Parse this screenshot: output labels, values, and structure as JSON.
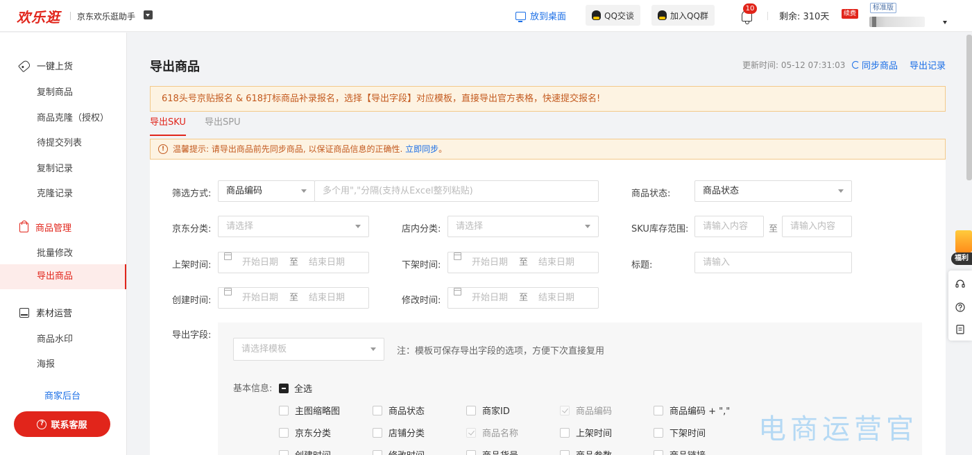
{
  "header": {
    "logo": "欢乐逛",
    "app_name": "京东欢乐逛助手",
    "desktop_link": "放到桌面",
    "qq_chat": "QQ交谈",
    "qq_group": "加入QQ群",
    "notif_count": "10",
    "remaining": "剩余: 310天",
    "renew": "续费",
    "plan": "标准版"
  },
  "sidebar": {
    "group1": "一键上货",
    "group1_items": [
      "复制商品",
      "商品克隆（授权）",
      "待提交列表",
      "复制记录",
      "克隆记录"
    ],
    "group2": "商品管理",
    "group2_items": [
      "批量修改",
      "导出商品"
    ],
    "group3": "素材运营",
    "group3_items": [
      "商品水印",
      "海报"
    ],
    "merchant_link": "商家后台",
    "contact": "联系客服"
  },
  "page": {
    "title": "导出商品",
    "updated": "更新时间: 05-12 07:31:03",
    "sync": "同步商品",
    "export_records": "导出记录",
    "notice": "618头号京贴报名 & 618打标商品补录报名，选择【导出字段】对应模板，直接导出官方表格，快速提交报名!",
    "tabs": [
      "导出SKU",
      "导出SPU"
    ],
    "warn_text": "温馨提示: 请导出商品前先同步商品, 以保证商品信息的正确性. ",
    "warn_link": "立即同步",
    "warn_end": "。"
  },
  "filters": {
    "filter_mode_label": "筛选方式:",
    "filter_mode_value": "商品编码",
    "filter_input_placeholder": "多个用\",\"分隔(支持从Excel整列粘贴)",
    "status_label": "商品状态:",
    "status_value": "商品状态",
    "jd_cat_label": "京东分类:",
    "jd_cat_placeholder": "请选择",
    "shop_cat_label": "店内分类:",
    "shop_cat_placeholder": "请选择",
    "stock_label": "SKU库存范围:",
    "stock_min_placeholder": "请输入内容",
    "to": "至",
    "stock_max_placeholder": "请输入内容",
    "on_time_label": "上架时间:",
    "off_time_label": "下架时间:",
    "title_label": "标题:",
    "title_placeholder": "请输入",
    "create_time_label": "创建时间:",
    "modify_time_label": "修改时间:",
    "start_date": "开始日期",
    "end_date": "结束日期"
  },
  "export_fields": {
    "label": "导出字段:",
    "template_placeholder": "请选择模板",
    "template_note": "注：模板可保存导出字段的选项，方便下次直接复用",
    "basic_label": "基本信息:",
    "select_all": "全选",
    "options": [
      {
        "label": "主图缩略图",
        "checked": false
      },
      {
        "label": "商品状态",
        "checked": false
      },
      {
        "label": "商家ID",
        "checked": false
      },
      {
        "label": "商品编码",
        "checked": true
      },
      {
        "label": "商品编码 + \",\"",
        "checked": false
      },
      {
        "label": "京东分类",
        "checked": false
      },
      {
        "label": "店铺分类",
        "checked": false
      },
      {
        "label": "商品名称",
        "checked": true
      },
      {
        "label": "上架时间",
        "checked": false
      },
      {
        "label": "下架时间",
        "checked": false
      },
      {
        "label": "创建时间",
        "checked": false
      },
      {
        "label": "修改时间",
        "checked": false
      },
      {
        "label": "商品货号",
        "checked": false
      },
      {
        "label": "商品参数",
        "checked": false
      },
      {
        "label": "商品链接",
        "checked": false
      }
    ]
  },
  "floating": {
    "gift_label": "福利"
  },
  "watermark": "电商运营官"
}
